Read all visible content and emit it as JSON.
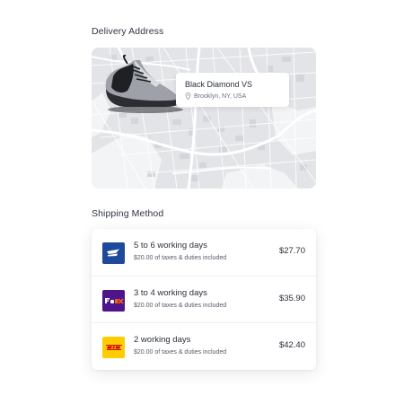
{
  "delivery": {
    "title": "Delivery Address",
    "product_name": "Black Diamond VS",
    "location": "Brooklyn, NY, USA",
    "pin_icon": "location-pin-icon"
  },
  "shipping": {
    "title": "Shipping Method",
    "options": [
      {
        "carrier": "USPS",
        "logo_icon": "usps-eagle-icon",
        "logo_color": "#1f4a9c",
        "days": "5 to 6 working days",
        "taxes": "$20.00 of taxes & duties included",
        "price": "$27.70"
      },
      {
        "carrier": "FedEx",
        "logo_icon": "fedex-logo-icon",
        "logo_color": "#4d148c",
        "days": "3 to 4 working days",
        "taxes": "$20.00 of taxes & duties included",
        "price": "$35.90"
      },
      {
        "carrier": "DHL",
        "logo_icon": "dhl-logo-icon",
        "logo_color": "#ffcc00",
        "days": "2 working days",
        "taxes": "$20.00 of taxes & duties included",
        "price": "$42.40"
      }
    ]
  }
}
